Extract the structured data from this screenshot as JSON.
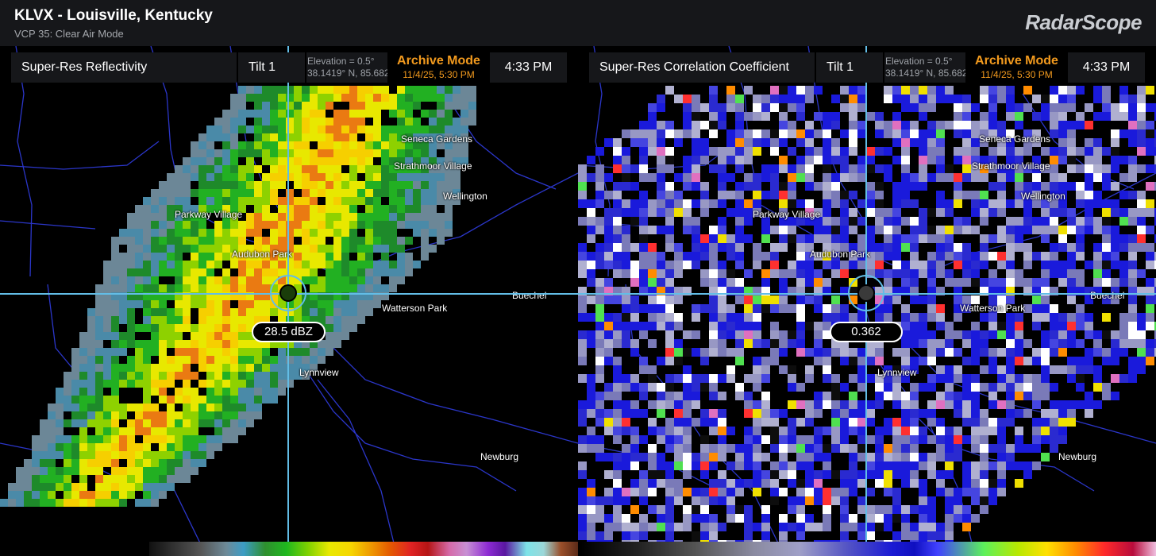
{
  "topbar": {
    "title": "KLVX - Louisville, Kentucky",
    "subtitle": "VCP 35: Clear Air Mode",
    "brand": "RadarScope"
  },
  "panels": [
    {
      "product": "Super-Res Reflectivity",
      "tilt": "Tilt 1",
      "elevation": "Elevation = 0.5°",
      "coords": "38.1419° N, 85.682",
      "archive_label": "Archive Mode",
      "archive_date": "11/4/25, 5:30 PM",
      "time": "4:33 PM",
      "readout": "28.5 dBZ",
      "places": [
        "Seneca Gardens",
        "Strathmoor Village",
        "Wellington",
        "Parkway Village",
        "Audubon Park",
        "Buechel",
        "Watterson Park",
        "Lynnview",
        "Newburg"
      ]
    },
    {
      "product": "Super-Res Correlation Coefficient",
      "tilt": "Tilt 1",
      "elevation": "Elevation = 0.5°",
      "coords": "38.1419° N, 85.682",
      "archive_label": "Archive Mode",
      "archive_date": "11/4/25, 5:30 PM",
      "time": "4:33 PM",
      "readout": "0.362",
      "places": [
        "Seneca Gardens",
        "Strathmoor Village",
        "Wellington",
        "Parkway Village",
        "Audubon Park",
        "Buechel",
        "Watterson Park",
        "Lynnview",
        "Newburg"
      ]
    }
  ],
  "colors": {
    "crosshair": "#62bde6",
    "archive": "#f29a1e",
    "roads": "#2b36c9",
    "cursor_left": "#1a3d0a",
    "cursor_right": "#3a3a3a"
  }
}
